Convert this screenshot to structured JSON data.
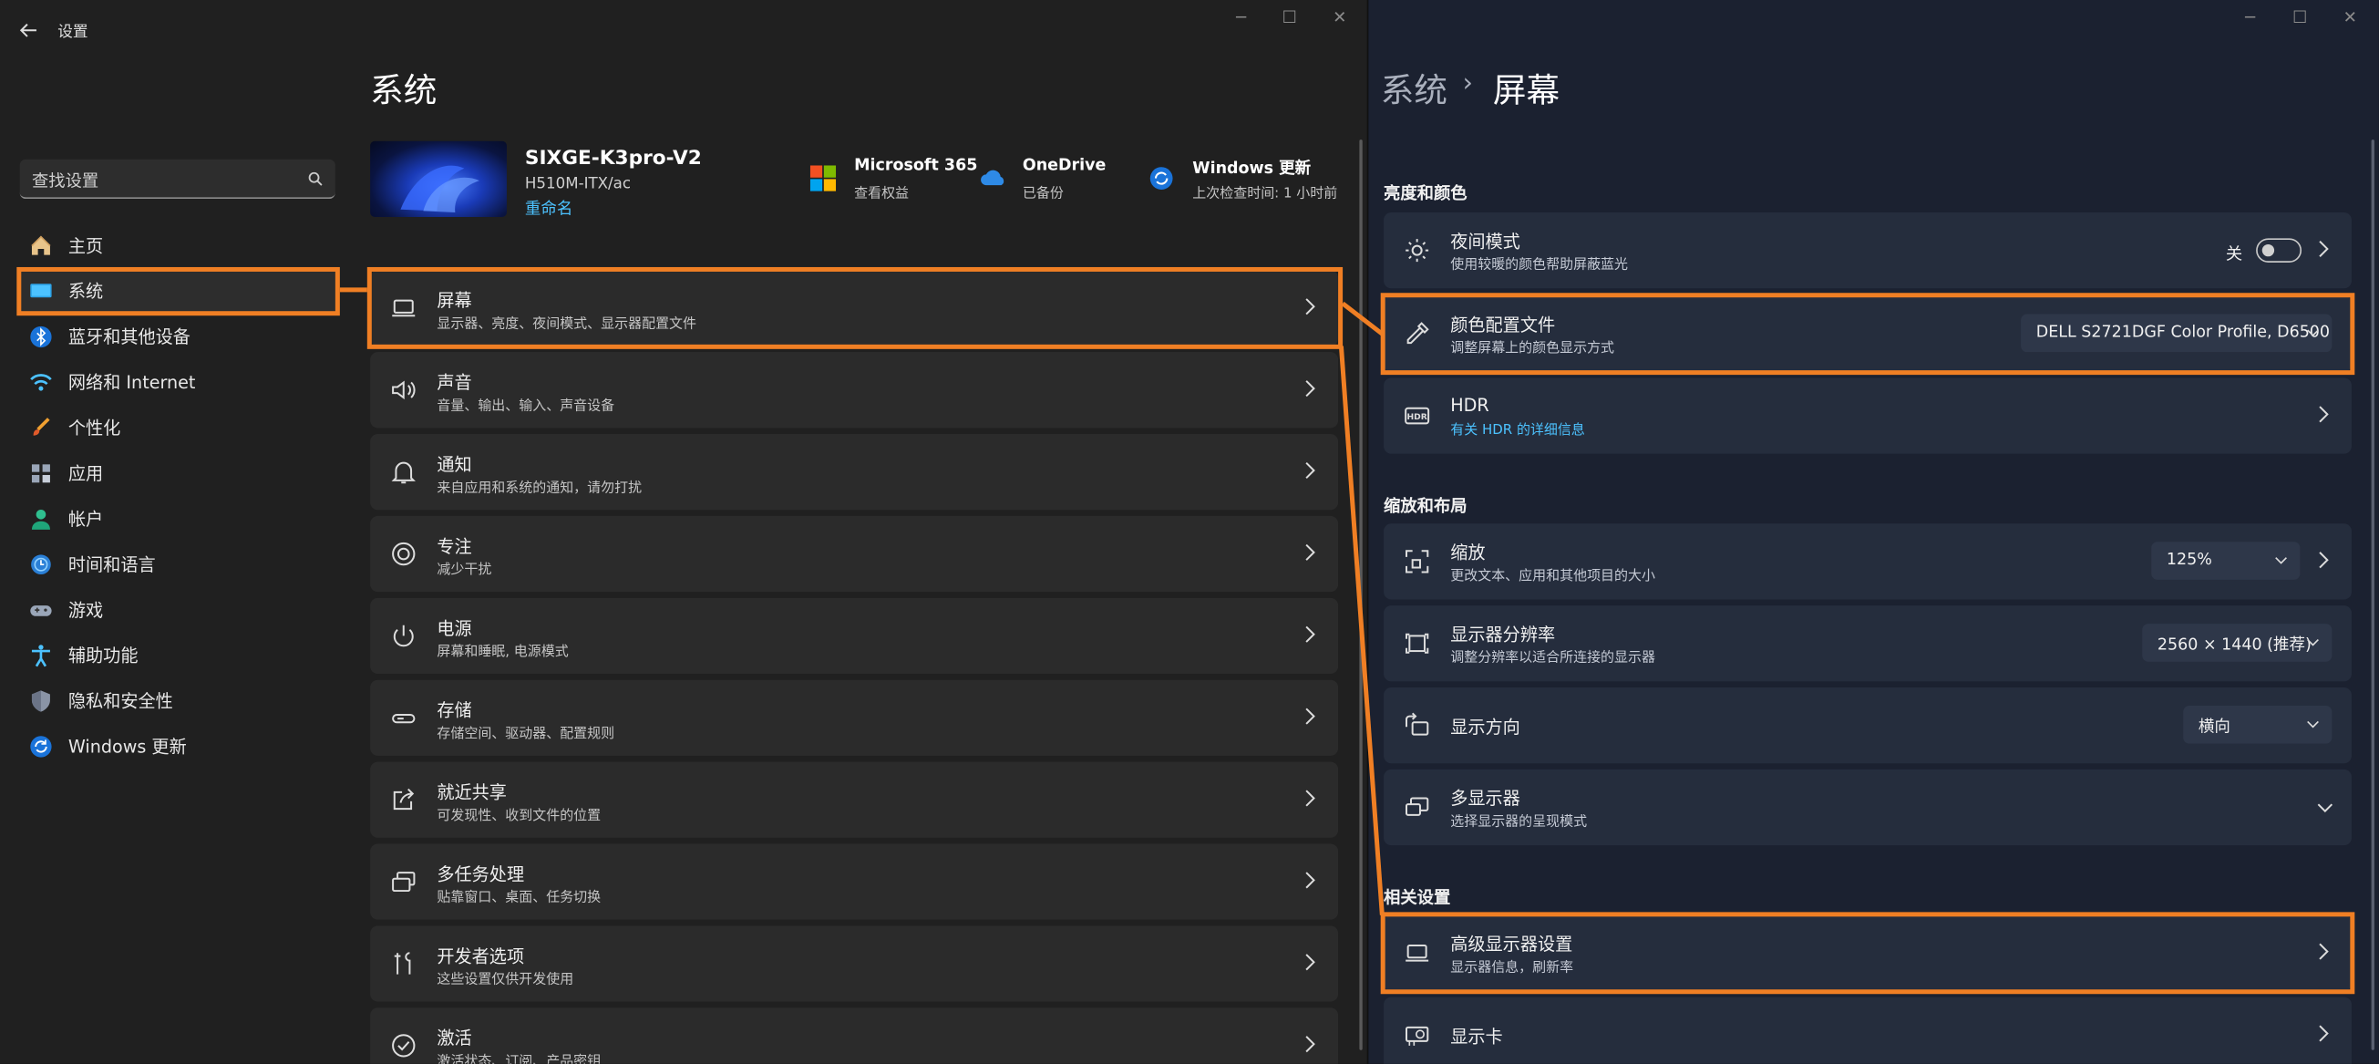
{
  "left_window": {
    "back_icon": "arrow-left-icon",
    "title": "设置",
    "controls": [
      "minimize",
      "maximize",
      "close"
    ],
    "search": {
      "placeholder": "查找设置",
      "icon": "search-icon"
    },
    "sidebar": {
      "items": [
        {
          "label": "主页",
          "icon": "home-icon",
          "selected": false
        },
        {
          "label": "系统",
          "icon": "monitor-icon",
          "selected": true
        },
        {
          "label": "蓝牙和其他设备",
          "icon": "bluetooth-icon",
          "selected": false
        },
        {
          "label": "网络和 Internet",
          "icon": "wifi-icon",
          "selected": false
        },
        {
          "label": "个性化",
          "icon": "brush-icon",
          "selected": false
        },
        {
          "label": "应用",
          "icon": "apps-icon",
          "selected": false
        },
        {
          "label": "帐户",
          "icon": "account-icon",
          "selected": false
        },
        {
          "label": "时间和语言",
          "icon": "globe-clock-icon",
          "selected": false
        },
        {
          "label": "游戏",
          "icon": "gamepad-icon",
          "selected": false
        },
        {
          "label": "辅助功能",
          "icon": "accessibility-icon",
          "selected": false
        },
        {
          "label": "隐私和安全性",
          "icon": "shield-icon",
          "selected": false
        },
        {
          "label": "Windows 更新",
          "icon": "update-icon",
          "selected": false
        }
      ]
    },
    "page_title": "系统",
    "device": {
      "name": "SIXGE-K3pro-V2",
      "model": "H510M-ITX/ac",
      "rename_link": "重命名"
    },
    "quick_links": [
      {
        "title": "Microsoft 365",
        "subtitle": "查看权益",
        "icon": "microsoft-logo-icon"
      },
      {
        "title": "OneDrive",
        "subtitle": "已备份",
        "icon": "cloud-icon"
      },
      {
        "title": "Windows 更新",
        "subtitle": "上次检查时间: 1 小时前",
        "icon": "update-icon"
      }
    ],
    "settings_list": [
      {
        "title": "屏幕",
        "subtitle": "显示器、亮度、夜间模式、显示器配置文件",
        "icon": "laptop-icon"
      },
      {
        "title": "声音",
        "subtitle": "音量、输出、输入、声音设备",
        "icon": "speaker-icon"
      },
      {
        "title": "通知",
        "subtitle": "来自应用和系统的通知，请勿打扰",
        "icon": "bell-icon"
      },
      {
        "title": "专注",
        "subtitle": "减少干扰",
        "icon": "focus-icon"
      },
      {
        "title": "电源",
        "subtitle": "屏幕和睡眠, 电源模式",
        "icon": "power-icon"
      },
      {
        "title": "存储",
        "subtitle": "存储空间、驱动器、配置规则",
        "icon": "storage-icon"
      },
      {
        "title": "就近共享",
        "subtitle": "可发现性、收到文件的位置",
        "icon": "share-icon"
      },
      {
        "title": "多任务处理",
        "subtitle": "贴靠窗口、桌面、任务切换",
        "icon": "multitask-icon"
      },
      {
        "title": "开发者选项",
        "subtitle": "这些设置仅供开发使用",
        "icon": "tools-icon"
      },
      {
        "title": "激活",
        "subtitle": "激活状态、订阅、产品密钥",
        "icon": "check-circle-icon"
      }
    ]
  },
  "right_window": {
    "controls": [
      "minimize",
      "maximize",
      "close"
    ],
    "breadcrumb": {
      "parent": "系统",
      "separator": "›",
      "current": "屏幕"
    },
    "sections": {
      "brightness": {
        "header": "亮度和颜色",
        "night_mode": {
          "title": "夜间模式",
          "subtitle": "使用较暖的颜色帮助屏蔽蓝光",
          "toggle_label": "关",
          "toggle_on": false,
          "icon": "brightness-icon"
        },
        "color_profile": {
          "title": "颜色配置文件",
          "subtitle": "调整屏幕上的颜色显示方式",
          "value": "DELL S2721DGF Color Profile, D6500",
          "icon": "eyedropper-icon"
        },
        "hdr": {
          "title": "HDR",
          "link": "有关 HDR 的详细信息",
          "icon": "hdr-icon"
        }
      },
      "scale": {
        "header": "缩放和布局",
        "scale": {
          "title": "缩放",
          "subtitle": "更改文本、应用和其他项目的大小",
          "value": "125%",
          "icon": "scale-icon"
        },
        "resolution": {
          "title": "显示器分辨率",
          "subtitle": "调整分辨率以适合所连接的显示器",
          "value": "2560 × 1440 (推荐)",
          "icon": "resolution-icon"
        },
        "orientation": {
          "title": "显示方向",
          "value": "横向",
          "icon": "rotate-icon"
        },
        "multi": {
          "title": "多显示器",
          "subtitle": "选择显示器的呈现模式",
          "icon": "multi-monitor-icon"
        }
      },
      "related": {
        "header": "相关设置",
        "advanced": {
          "title": "高级显示器设置",
          "subtitle": "显示器信息，刷新率",
          "icon": "laptop-icon"
        },
        "gpu": {
          "title": "显示卡",
          "icon": "gpu-icon"
        }
      }
    }
  },
  "colors": {
    "highlight": "#f07f24",
    "accent": "#4cc2ff",
    "left_bg": "#202020",
    "right_bg": "#1b2130"
  }
}
